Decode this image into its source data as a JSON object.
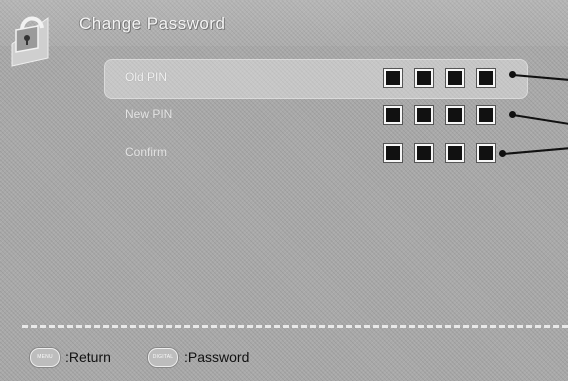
{
  "header": {
    "title": "Change Password",
    "icon": "lock-icon"
  },
  "rows": [
    {
      "label": "Old PIN",
      "selected": true,
      "pin_digits": 4
    },
    {
      "label": "New PIN",
      "selected": false,
      "pin_digits": 4
    },
    {
      "label": "Confirm",
      "selected": false,
      "pin_digits": 4
    }
  ],
  "footer": {
    "menu_key": "MENU",
    "menu_action": ":Return",
    "digital_key": "DIGITAL",
    "digital_action": ":Password"
  }
}
